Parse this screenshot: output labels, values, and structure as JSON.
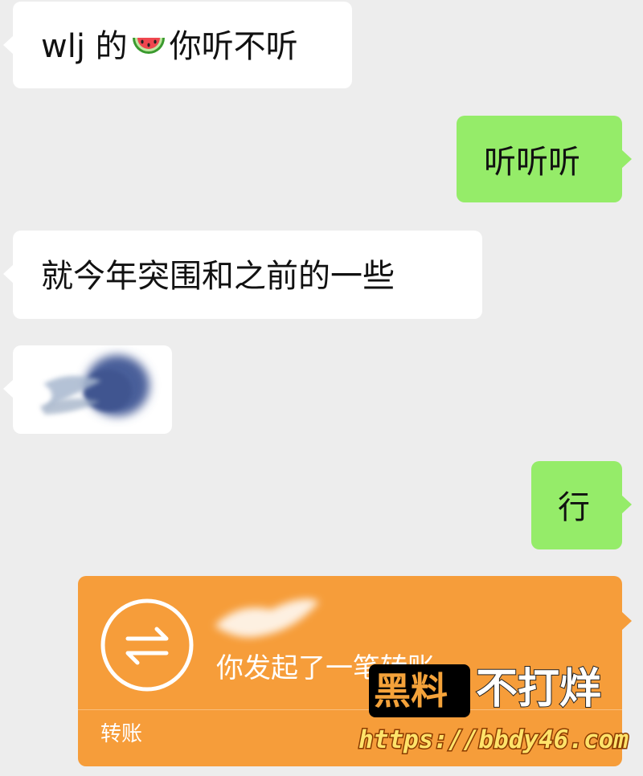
{
  "messages": [
    {
      "side": "left",
      "text_before": "wlj 的",
      "emoji": "watermelon-icon",
      "text_after": "你听不听"
    },
    {
      "side": "right",
      "text": "听听听"
    },
    {
      "side": "left",
      "text": "就今年突围和之前的一些"
    },
    {
      "side": "left",
      "type": "sticker"
    },
    {
      "side": "right",
      "text": "行"
    }
  ],
  "transfer": {
    "description": "你发起了一笔转账",
    "type_label": "转账",
    "icon": "transfer-arrows-icon"
  },
  "watermark": {
    "brand": "黑料",
    "slogan": "不打烊",
    "url": "https://bbdy46.com"
  },
  "colors": {
    "background": "#ededed",
    "incoming_bubble": "#ffffff",
    "outgoing_bubble": "#95ec69",
    "transfer_card": "#f69d3a"
  }
}
